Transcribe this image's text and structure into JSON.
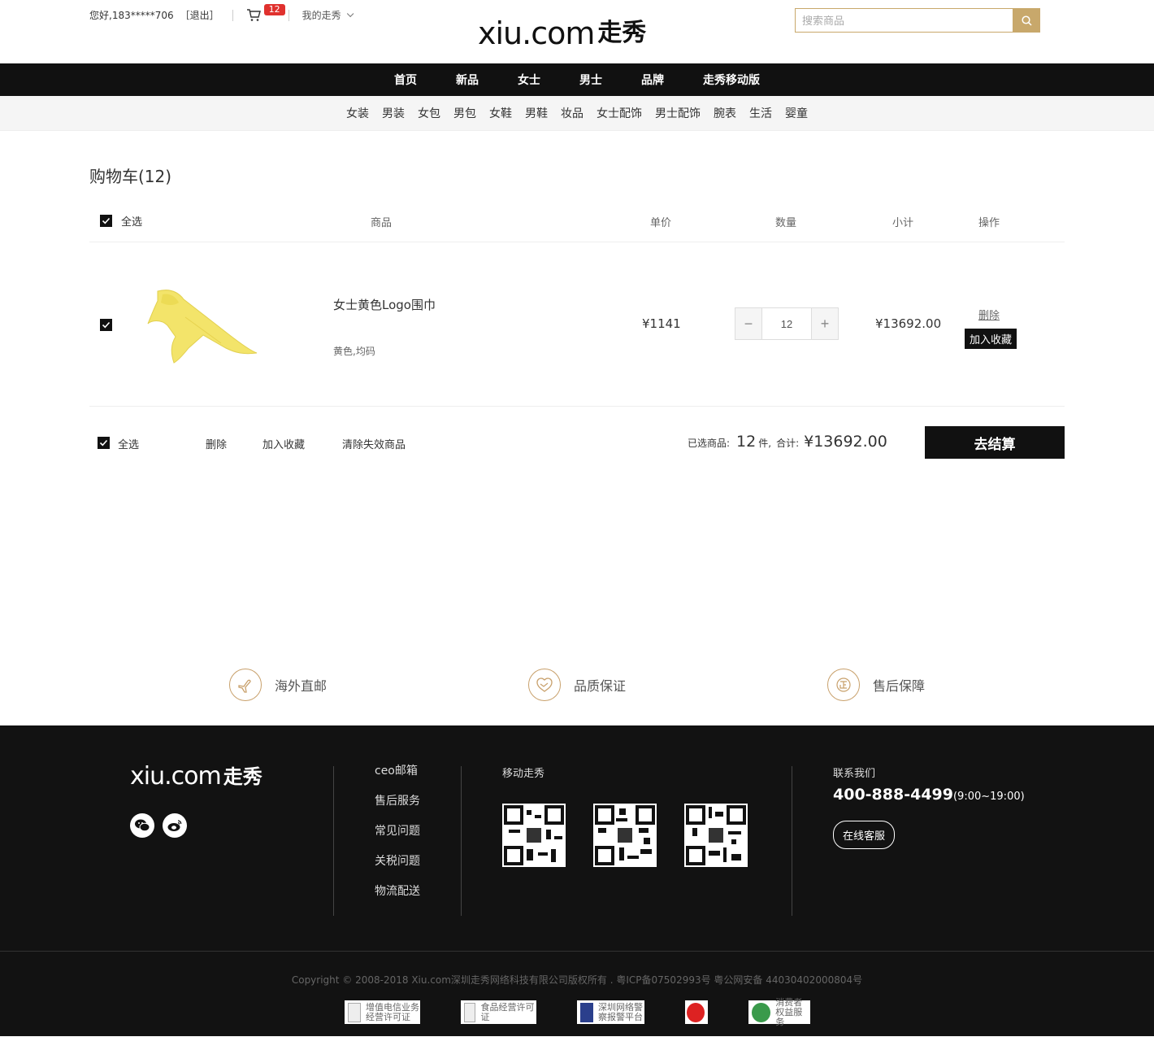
{
  "header": {
    "greeting": "您好,183*****706",
    "logout": "［退出］",
    "cart_count": "12",
    "my_xiu": "我的走秀",
    "logo_latin": "xiu.com",
    "logo_cn": "走秀",
    "search_placeholder": "搜索商品"
  },
  "nav_primary": [
    "首页",
    "新品",
    "女士",
    "男士",
    "品牌",
    "走秀移动版"
  ],
  "nav_secondary": [
    "女装",
    "男装",
    "女包",
    "男包",
    "女鞋",
    "男鞋",
    "妆品",
    "女士配饰",
    "男士配饰",
    "腕表",
    "生活",
    "婴童"
  ],
  "cart": {
    "title": "购物车(12)",
    "head": {
      "select_all": "全选",
      "product": "商品",
      "unit_price": "单价",
      "quantity": "数量",
      "subtotal": "小计",
      "action": "操作"
    },
    "items": [
      {
        "name": "女士黄色Logo围巾",
        "spec": "黄色,均码",
        "price": "¥1141",
        "quantity": "12",
        "subtotal": "¥13692.00",
        "delete": "删除",
        "favorite": "加入收藏"
      }
    ],
    "footer": {
      "select_all": "全选",
      "delete": "删除",
      "favorite": "加入收藏",
      "clear_invalid": "清除失效商品",
      "selected_label": "已选商品:",
      "selected_count": "12",
      "count_unit": "件,",
      "total_label": "合计:",
      "total": "¥13692.00",
      "checkout": "去结算"
    }
  },
  "services": [
    "海外直邮",
    "品质保证",
    "售后保障"
  ],
  "footer": {
    "logo_latin": "xiu.com",
    "logo_cn": "走秀",
    "links": [
      "ceo邮箱",
      "售后服务",
      "常见问题",
      "关税问题",
      "物流配送"
    ],
    "mobile_title": "移动走秀",
    "contact_title": "联系我们",
    "phone": "400-888-4499",
    "hours": "(9:00~19:00)",
    "online_service": "在线客服",
    "copyright": "Copyright © 2008-2018 Xiu.com深圳走秀网络科技有限公司版权所有 . 粤ICP备07502993号 粤公网安备 44030402000804号",
    "badges": [
      {
        "line1": "增值电信业务",
        "line2": "经营许可证"
      },
      {
        "line1": "食品经营许可证",
        "line2": ""
      },
      {
        "line1": "深圳网络警",
        "line2": "察报警平台"
      },
      {
        "line1": "",
        "line2": ""
      },
      {
        "line1": "消费者",
        "line2": "权益服务"
      }
    ]
  },
  "colors": {
    "accent_gold": "#c8a86b",
    "badge_red": "#e0312e",
    "dark": "#111111"
  }
}
